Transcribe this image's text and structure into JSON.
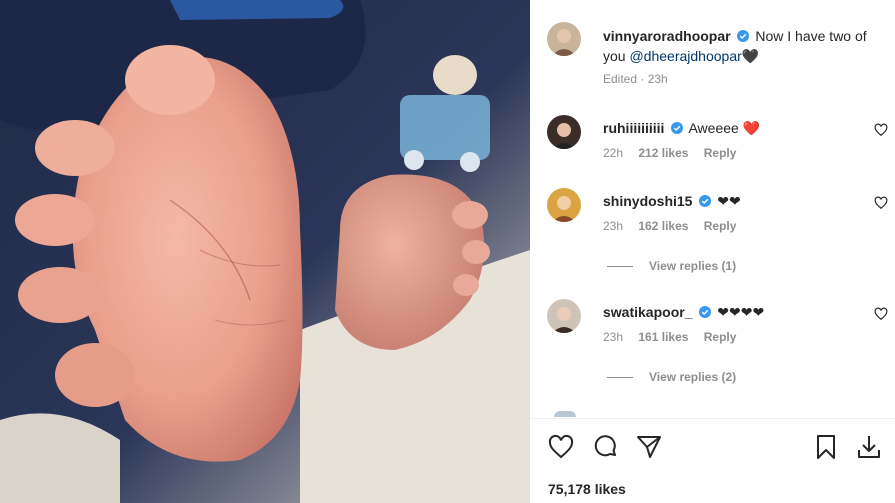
{
  "post": {
    "author": "vinnyaroradhoopar",
    "caption_text": "Now I have two of you",
    "caption_mention": "@dheerajdhoopar",
    "caption_end": "🖤",
    "edited_label": "Edited",
    "time": "23h",
    "likes_label": "75,178 likes"
  },
  "comments": [
    {
      "username": "ruhiiiiiiiiii",
      "text": "Aweeee ❤️",
      "time": "22h",
      "likes": "212 likes",
      "reply": "Reply"
    },
    {
      "username": "shinydoshi15",
      "text": "❤❤",
      "time": "23h",
      "likes": "162 likes",
      "reply": "Reply",
      "view_replies": "View replies (1)"
    },
    {
      "username": "swatikapoor_",
      "text": "❤❤❤❤",
      "time": "23h",
      "likes": "161 likes",
      "reply": "Reply",
      "view_replies": "View replies (2)"
    }
  ],
  "colors": {
    "verified": "#3897f0",
    "mention": "#00376b",
    "muted": "#8e8e8e"
  },
  "icons": [
    "heart-icon",
    "comment-icon",
    "share-icon",
    "bookmark-icon",
    "download-icon",
    "verified-icon"
  ]
}
